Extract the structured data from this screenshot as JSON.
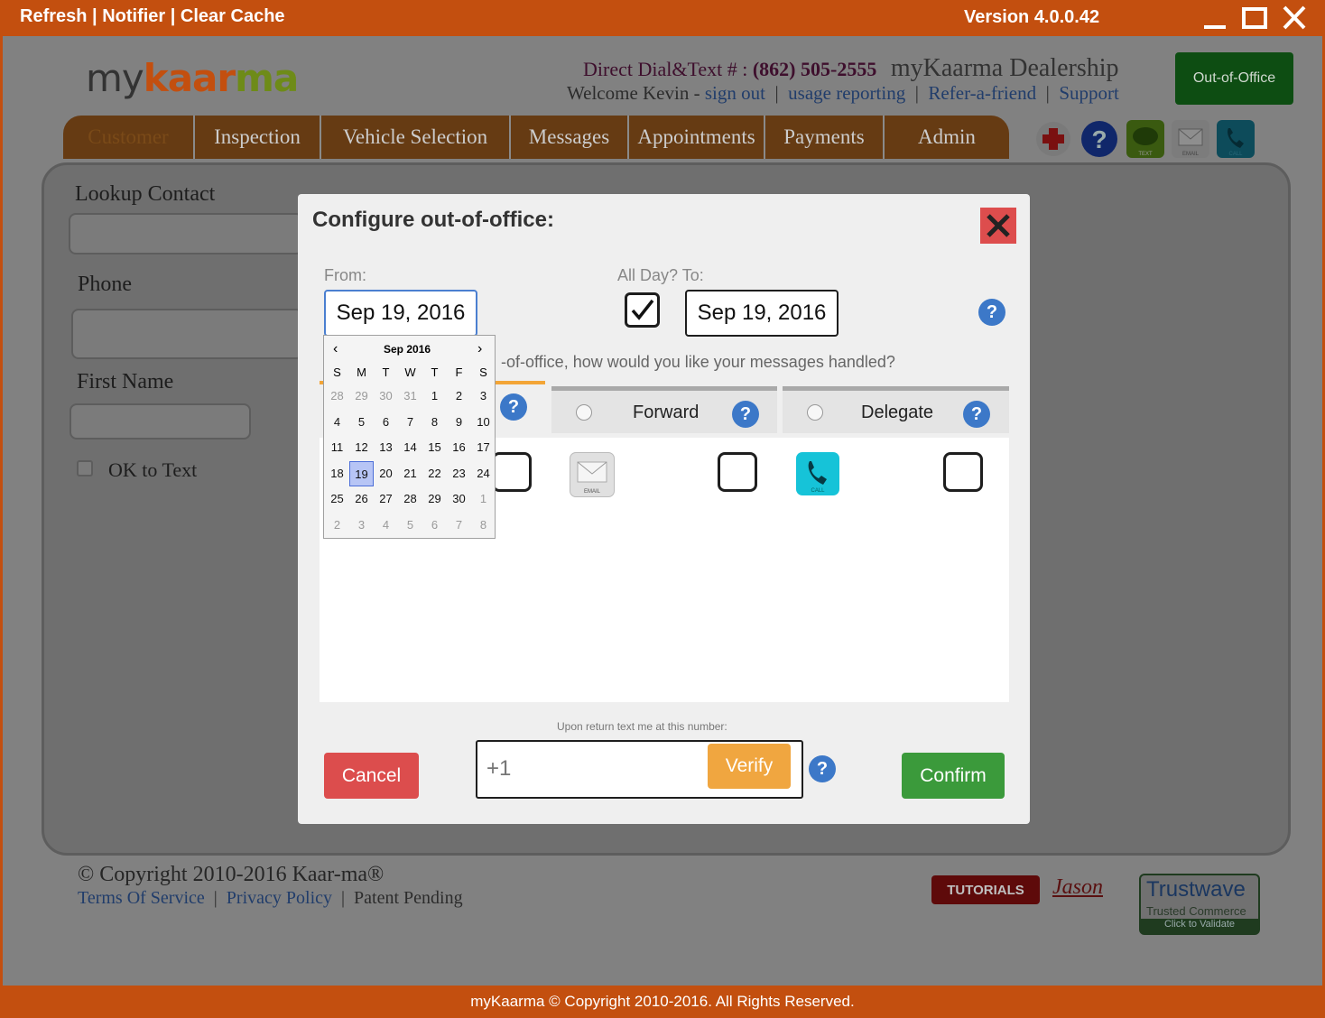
{
  "titlebar": {
    "refresh": "Refresh",
    "notifier": "Notifier",
    "clear_cache": "Clear Cache",
    "version": "Version 4.0.0.42"
  },
  "header": {
    "logo_my": "my",
    "logo_k": "kaar",
    "logo_ma": "ma",
    "direct_dial_label": "Direct Dial&Text # :",
    "direct_dial_number": "(862) 505-2555",
    "dealership": "myKaarma Dealership",
    "welcome": "Welcome Kevin",
    "sign_out": "sign out",
    "usage_reporting": "usage reporting",
    "refer": "Refer-a-friend",
    "support": "Support",
    "out_of_office": "Out-of-Office"
  },
  "nav": {
    "tabs": [
      "Customer",
      "Inspection",
      "Vehicle Selection",
      "Messages",
      "Appointments",
      "Payments",
      "Admin"
    ],
    "icons": {
      "text": "TEXT",
      "email": "EMAIL",
      "call": "CALL"
    }
  },
  "panel": {
    "lookup": "Lookup Contact",
    "phone": "Phone",
    "first_name": "First Name",
    "ok_to_text": "OK to Text"
  },
  "footer": {
    "copyright": "© Copyright 2010-2016 Kaar-ma®",
    "terms": "Terms Of Service",
    "privacy": "Privacy Policy",
    "patent": "Patent Pending",
    "tutorials": "TUTORIALS",
    "jason": "Jason",
    "trustwave": "Trustwave",
    "trusted": "Trusted Commerce",
    "validate": "Click to Validate",
    "bar": "myKaarma © Copyright 2010-2016.  All Rights Reserved."
  },
  "modal": {
    "title": "Configure out-of-office:",
    "from_label": "From:",
    "from_value": "Sep 19, 2016",
    "allday_label": "All Day? To:",
    "to_value": "Sep 19, 2016",
    "question": "-of-office, how would you like your messages handled?",
    "forward": "Forward",
    "delegate": "Delegate",
    "email_icon": "EMAIL",
    "call_icon": "CALL",
    "return_label": "Upon return text me at this number:",
    "phone_placeholder": "+1",
    "verify": "Verify",
    "cancel": "Cancel",
    "confirm": "Confirm"
  },
  "calendar": {
    "month": "Sep 2016",
    "prev": "‹",
    "next": "›",
    "dow": [
      "S",
      "M",
      "T",
      "W",
      "T",
      "F",
      "S"
    ],
    "weeks": [
      [
        "28",
        "29",
        "30",
        "31",
        "1",
        "2",
        "3"
      ],
      [
        "4",
        "5",
        "6",
        "7",
        "8",
        "9",
        "10"
      ],
      [
        "11",
        "12",
        "13",
        "14",
        "15",
        "16",
        "17"
      ],
      [
        "18",
        "19",
        "20",
        "21",
        "22",
        "23",
        "24"
      ],
      [
        "25",
        "26",
        "27",
        "28",
        "29",
        "30",
        "1"
      ],
      [
        "2",
        "3",
        "4",
        "5",
        "6",
        "7",
        "8"
      ]
    ],
    "selected": "19"
  },
  "colors": {
    "brand_orange": "#c34f0f",
    "confirm_green": "#3b9a3b",
    "cancel_red": "#dc4d4d",
    "verify_orange": "#f0a640",
    "help_blue": "#3c78c8"
  }
}
